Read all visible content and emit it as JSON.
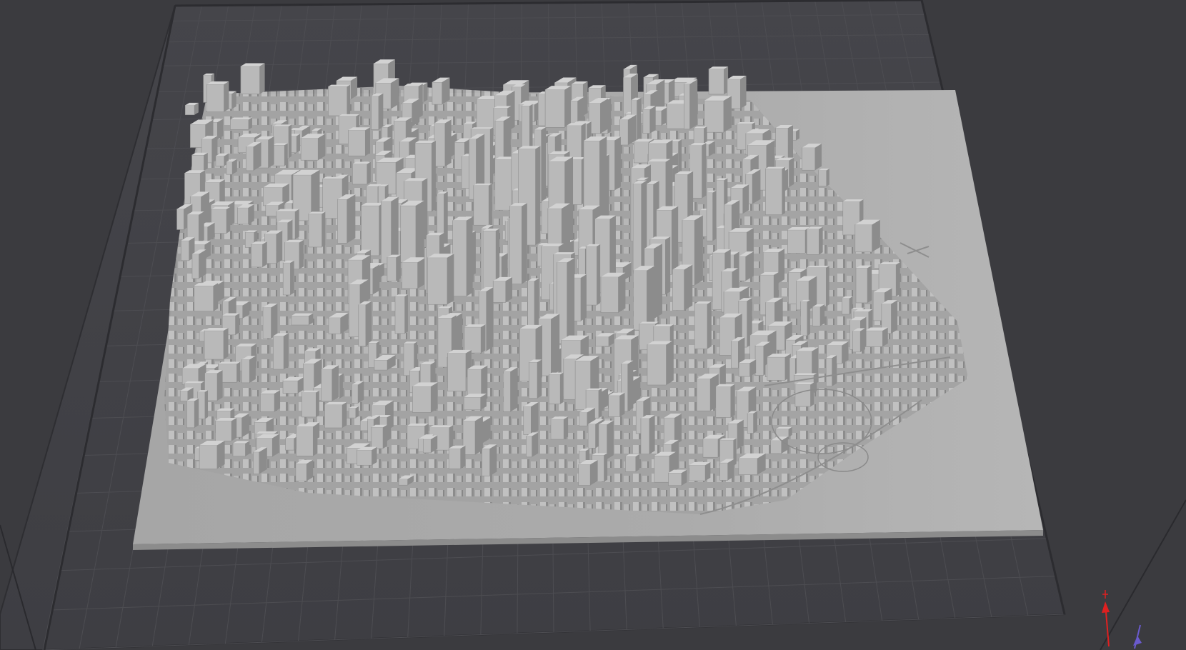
{
  "viewport": {
    "background_color": "#3b3b3f",
    "build_plate_color": "#444449",
    "grid_line_color": "#4e4e53",
    "model_color": "#a9a9a9",
    "model_light_color": "#c4c4c4",
    "model_dark_color": "#7a7a7a"
  },
  "model": {
    "description_icon": "city-model-icon"
  },
  "axis_gizmo": {
    "z_axis_color": "#e02020",
    "y_axis_color": "#6a5acd"
  }
}
